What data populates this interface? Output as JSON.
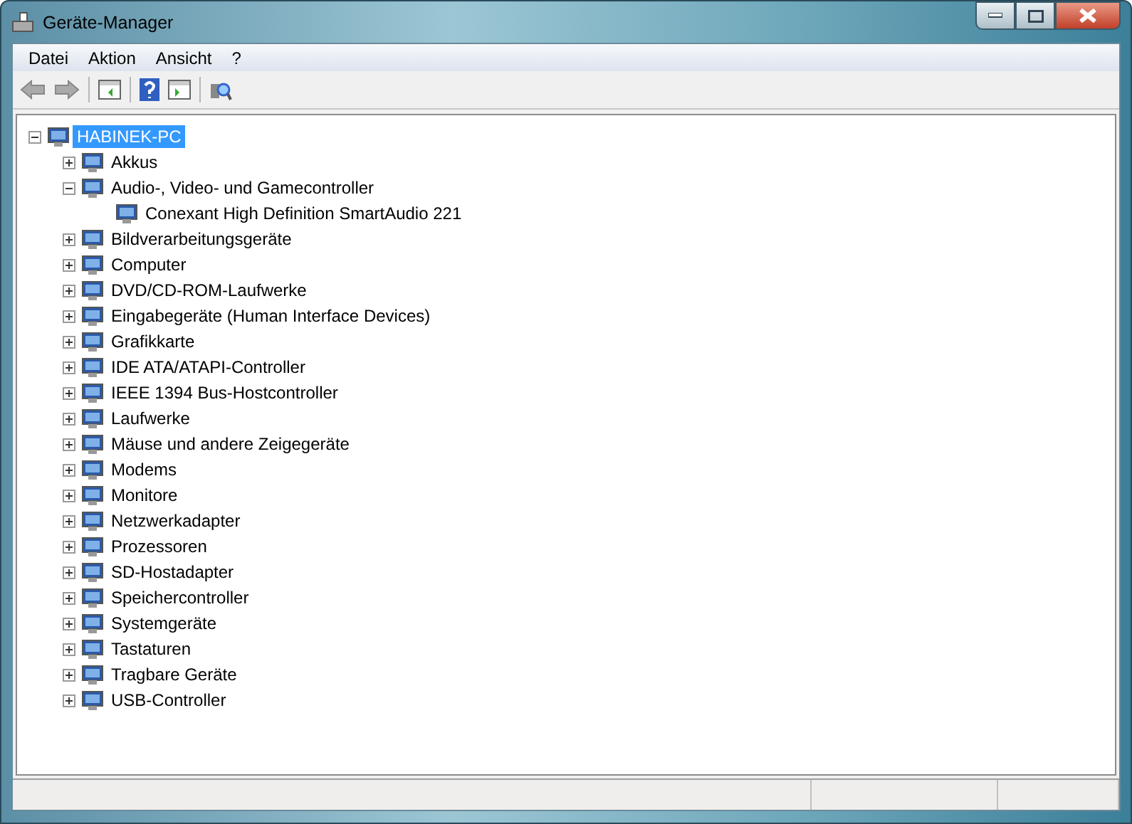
{
  "window": {
    "title": "Geräte-Manager"
  },
  "menu": [
    "Datei",
    "Aktion",
    "Ansicht",
    "?"
  ],
  "tree": [
    {
      "label": "HABINEK-PC",
      "selected": true,
      "expanded": true,
      "children": [
        {
          "label": "Akkus",
          "selected": false,
          "expanded": false
        },
        {
          "label": "Audio-, Video- und Gamecontroller",
          "selected": false,
          "expanded": true,
          "children": [
            {
              "label": "Conexant High Definition SmartAudio 221",
              "selected": false
            }
          ]
        },
        {
          "label": "Bildverarbeitungsgeräte",
          "selected": false,
          "expanded": false
        },
        {
          "label": "Computer",
          "selected": false,
          "expanded": false
        },
        {
          "label": "DVD/CD-ROM-Laufwerke",
          "selected": false,
          "expanded": false
        },
        {
          "label": "Eingabegeräte (Human Interface Devices)",
          "selected": false,
          "expanded": false
        },
        {
          "label": "Grafikkarte",
          "selected": false,
          "expanded": false
        },
        {
          "label": "IDE ATA/ATAPI-Controller",
          "selected": false,
          "expanded": false
        },
        {
          "label": "IEEE 1394 Bus-Hostcontroller",
          "selected": false,
          "expanded": false
        },
        {
          "label": "Laufwerke",
          "selected": false,
          "expanded": false
        },
        {
          "label": "Mäuse und andere Zeigegeräte",
          "selected": false,
          "expanded": false
        },
        {
          "label": "Modems",
          "selected": false,
          "expanded": false
        },
        {
          "label": "Monitore",
          "selected": false,
          "expanded": false
        },
        {
          "label": "Netzwerkadapter",
          "selected": false,
          "expanded": false
        },
        {
          "label": "Prozessoren",
          "selected": false,
          "expanded": false
        },
        {
          "label": "SD-Hostadapter",
          "selected": false,
          "expanded": false
        },
        {
          "label": "Speichercontroller",
          "selected": false,
          "expanded": false
        },
        {
          "label": "Systemgeräte",
          "selected": false,
          "expanded": false
        },
        {
          "label": "Tastaturen",
          "selected": false,
          "expanded": false
        },
        {
          "label": "Tragbare Geräte",
          "selected": false,
          "expanded": false
        },
        {
          "label": "USB-Controller",
          "selected": false,
          "expanded": false
        }
      ]
    }
  ]
}
